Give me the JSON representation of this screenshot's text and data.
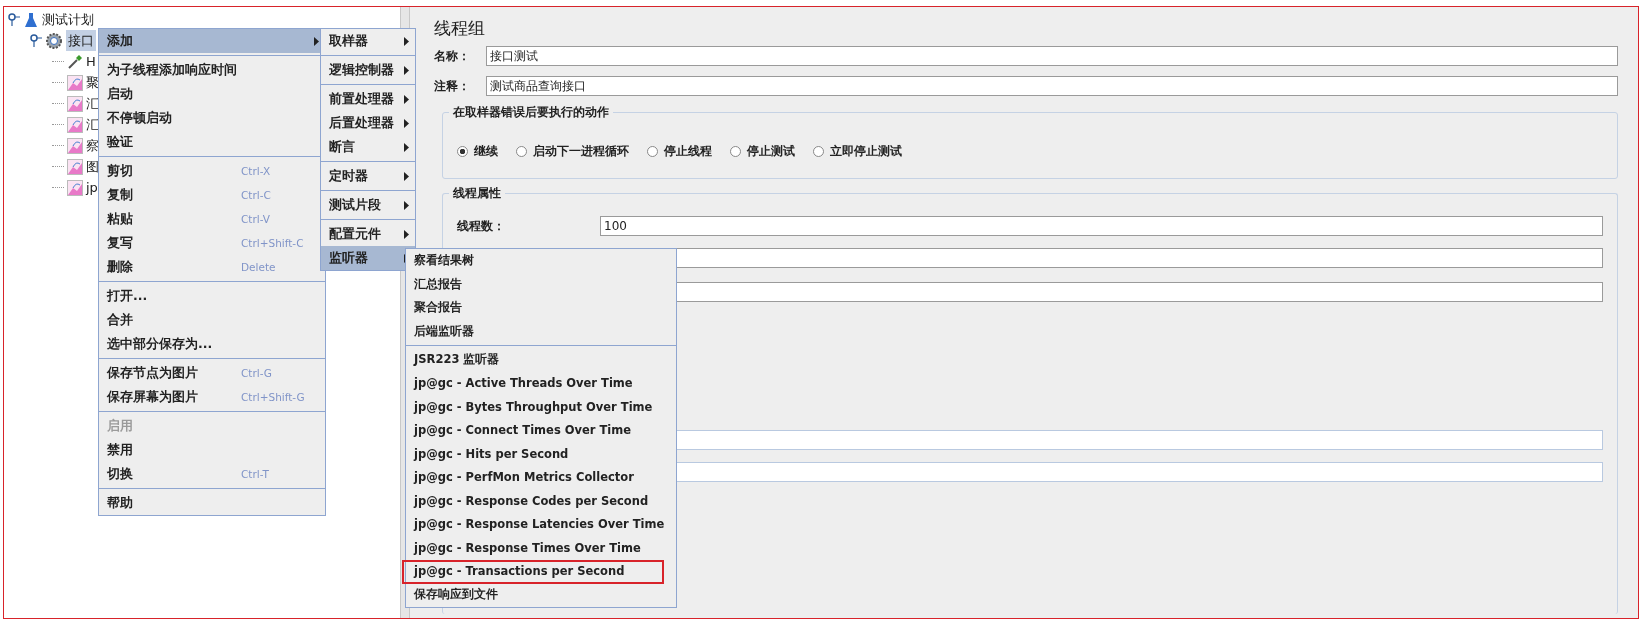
{
  "tree": {
    "items": [
      {
        "label": "测试计划",
        "kind": "flask",
        "expanded": true,
        "children": [
          {
            "label": "接口",
            "kind": "gear",
            "expanded": true,
            "selected": true,
            "children": [
              {
                "label": "H",
                "kind": "pipette",
                "selected": false
              },
              {
                "label": "聚",
                "kind": "chart",
                "selected": false
              },
              {
                "label": "汇",
                "kind": "chart",
                "selected": false
              },
              {
                "label": "汇",
                "kind": "chart",
                "selected": false
              },
              {
                "label": "察",
                "kind": "chart",
                "selected": false
              },
              {
                "label": "图",
                "kind": "chart",
                "selected": false
              },
              {
                "label": "jp",
                "kind": "chart",
                "selected": false
              }
            ]
          }
        ]
      }
    ]
  },
  "context_menu": {
    "groups": [
      [
        {
          "label": "添加",
          "arrow": true,
          "selected": true,
          "disabled": false
        }
      ],
      [
        {
          "label": "为子线程添加响应时间",
          "arrow": false,
          "selected": false,
          "disabled": false
        },
        {
          "label": "启动",
          "arrow": false,
          "selected": false,
          "disabled": false
        },
        {
          "label": "不停顿启动",
          "arrow": false,
          "selected": false,
          "disabled": false
        },
        {
          "label": "验证",
          "arrow": false,
          "selected": false,
          "disabled": false
        }
      ],
      [
        {
          "label": "剪切",
          "shortcut": "Ctrl-X",
          "arrow": false,
          "selected": false,
          "disabled": false
        },
        {
          "label": "复制",
          "shortcut": "Ctrl-C",
          "arrow": false,
          "selected": false,
          "disabled": false
        },
        {
          "label": "粘贴",
          "shortcut": "Ctrl-V",
          "arrow": false,
          "selected": false,
          "disabled": false
        },
        {
          "label": "复写",
          "shortcut": "Ctrl+Shift-C",
          "arrow": false,
          "selected": false,
          "disabled": false
        },
        {
          "label": "删除",
          "shortcut": "Delete",
          "arrow": false,
          "selected": false,
          "disabled": false
        }
      ],
      [
        {
          "label": "打开...",
          "arrow": false,
          "selected": false,
          "disabled": false
        },
        {
          "label": "合并",
          "arrow": false,
          "selected": false,
          "disabled": false
        },
        {
          "label": "选中部分保存为...",
          "arrow": false,
          "selected": false,
          "disabled": false
        }
      ],
      [
        {
          "label": "保存节点为图片",
          "shortcut": "Ctrl-G",
          "arrow": false,
          "selected": false,
          "disabled": false
        },
        {
          "label": "保存屏幕为图片",
          "shortcut": "Ctrl+Shift-G",
          "arrow": false,
          "selected": false,
          "disabled": false
        }
      ],
      [
        {
          "label": "启用",
          "arrow": false,
          "selected": false,
          "disabled": true
        },
        {
          "label": "禁用",
          "arrow": false,
          "selected": false,
          "disabled": false
        },
        {
          "label": "切换",
          "shortcut": "Ctrl-T",
          "arrow": false,
          "selected": false,
          "disabled": false
        }
      ],
      [
        {
          "label": "帮助",
          "arrow": false,
          "selected": false,
          "disabled": false
        }
      ]
    ]
  },
  "add_submenu": {
    "groups": [
      [
        {
          "label": "取样器",
          "arrow": true,
          "selected": false
        }
      ],
      [
        {
          "label": "逻辑控制器",
          "arrow": true,
          "selected": false
        }
      ],
      [
        {
          "label": "前置处理器",
          "arrow": true,
          "selected": false
        },
        {
          "label": "后置处理器",
          "arrow": true,
          "selected": false
        },
        {
          "label": "断言",
          "arrow": true,
          "selected": false
        }
      ],
      [
        {
          "label": "定时器",
          "arrow": true,
          "selected": false
        }
      ],
      [
        {
          "label": "测试片段",
          "arrow": true,
          "selected": false
        }
      ],
      [
        {
          "label": "配置元件",
          "arrow": true,
          "selected": false
        },
        {
          "label": "监听器",
          "arrow": true,
          "selected": true
        }
      ]
    ]
  },
  "listener_submenu": {
    "groups": [
      [
        {
          "label": "察看结果树",
          "marked": false
        },
        {
          "label": "汇总报告",
          "marked": false
        },
        {
          "label": "聚合报告",
          "marked": false
        },
        {
          "label": "后端监听器",
          "marked": false
        }
      ],
      [
        {
          "label": "JSR223 监听器",
          "marked": false
        },
        {
          "label": "jp@gc - Active Threads Over Time",
          "marked": false
        },
        {
          "label": "jp@gc - Bytes Throughput Over Time",
          "marked": false
        },
        {
          "label": "jp@gc - Connect Times Over Time",
          "marked": false
        },
        {
          "label": "jp@gc - Hits per Second",
          "marked": false
        },
        {
          "label": "jp@gc - PerfMon Metrics Collector",
          "marked": false
        },
        {
          "label": "jp@gc - Response Codes per Second",
          "marked": false
        },
        {
          "label": "jp@gc - Response Latencies Over Time",
          "marked": false
        },
        {
          "label": "jp@gc - Response Times Over Time",
          "marked": false
        },
        {
          "label": "jp@gc - Transactions per Second",
          "marked": true
        },
        {
          "label": "保存响应到文件",
          "marked": false
        }
      ]
    ]
  },
  "panel": {
    "title": "线程组",
    "name": {
      "label": "名称：",
      "value": "接口测试"
    },
    "comment": {
      "label": "注释：",
      "value": "测试商品查询接口"
    },
    "error_action": {
      "title": "在取样器错误后要执行的动作",
      "options": [
        {
          "label": "继续",
          "selected": true
        },
        {
          "label": "启动下一进程循环",
          "selected": false
        },
        {
          "label": "停止线程",
          "selected": false
        },
        {
          "label": "停止测试",
          "selected": false
        },
        {
          "label": "立即停止测试",
          "selected": false
        }
      ]
    },
    "thread_properties": {
      "title": "线程属性",
      "threads": {
        "label": "线程数：",
        "value": "100"
      }
    }
  }
}
